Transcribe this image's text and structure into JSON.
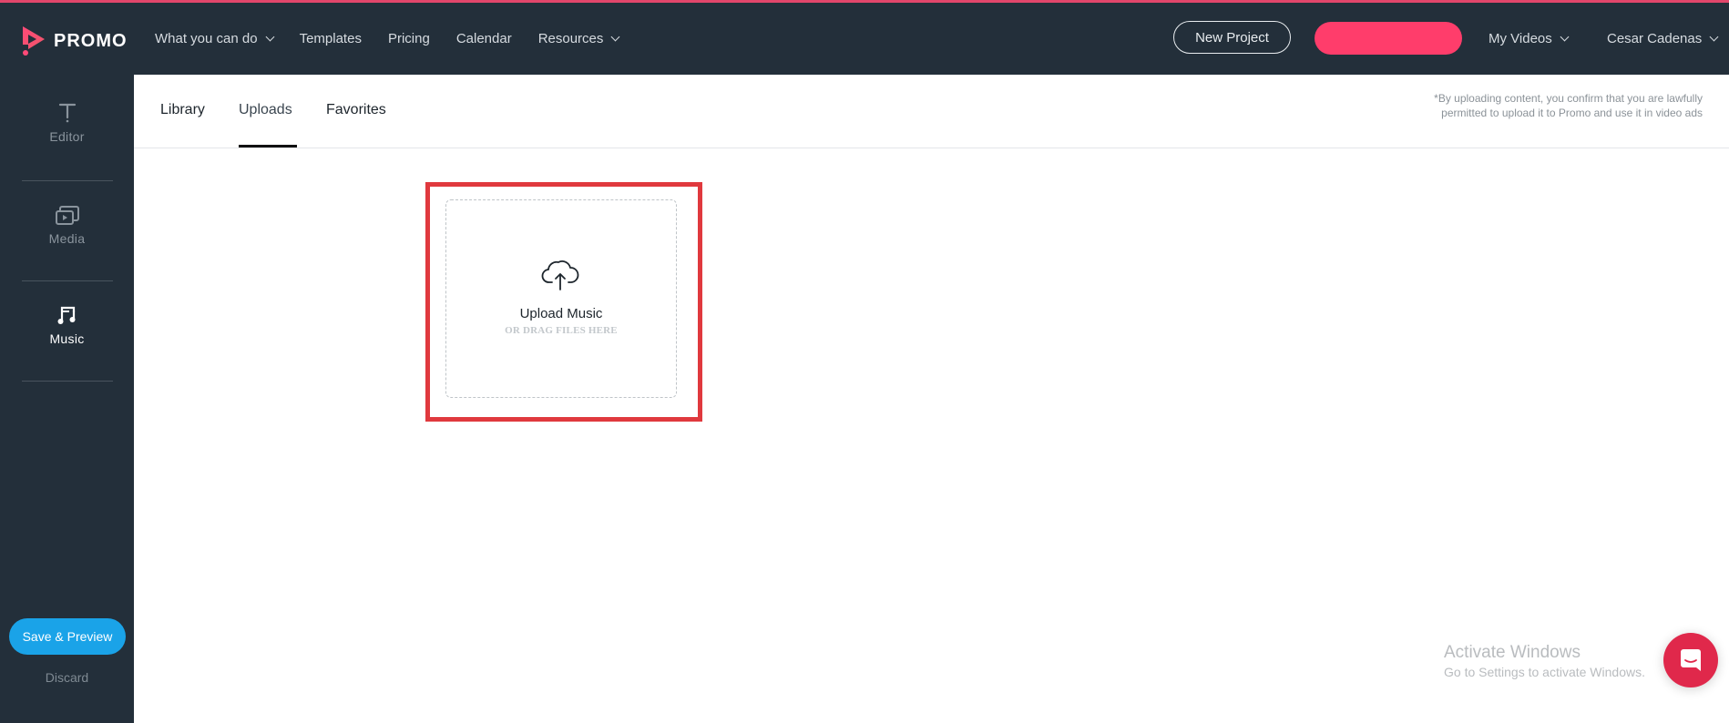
{
  "brand": {
    "name": "PROMO",
    "accent": "#ff3d6b",
    "header_bg": "#232f3a"
  },
  "nav": {
    "items": [
      {
        "label": "What you can do",
        "dropdown": true
      },
      {
        "label": "Templates",
        "dropdown": false
      },
      {
        "label": "Pricing",
        "dropdown": false
      },
      {
        "label": "Calendar",
        "dropdown": false
      },
      {
        "label": "Resources",
        "dropdown": true
      }
    ],
    "new_project_label": "New Project",
    "cta_label": "",
    "my_videos_label": "My Videos",
    "user_name": "Cesar Cadenas"
  },
  "sidebar": {
    "items": [
      {
        "label": "Editor",
        "icon": "text-icon",
        "active": false
      },
      {
        "label": "Media",
        "icon": "media-icon",
        "active": false
      },
      {
        "label": "Music",
        "icon": "music-icon",
        "active": true
      }
    ],
    "save_preview_label": "Save & Preview",
    "discard_label": "Discard"
  },
  "tabs": {
    "items": [
      {
        "label": "Library",
        "active": false
      },
      {
        "label": "Uploads",
        "active": true
      },
      {
        "label": "Favorites",
        "active": false
      }
    ],
    "disclaimer": "*By uploading content, you confirm that you are lawfully permitted to upload it to Promo and use it in video ads"
  },
  "upload": {
    "title": "Upload Music",
    "subtitle": "OR DRAG FILES HERE",
    "icon": "cloud-upload-icon"
  },
  "watermark": {
    "line1": "Activate Windows",
    "line2": "Go to Settings to activate Windows."
  },
  "chat": {
    "icon": "chat-icon"
  }
}
